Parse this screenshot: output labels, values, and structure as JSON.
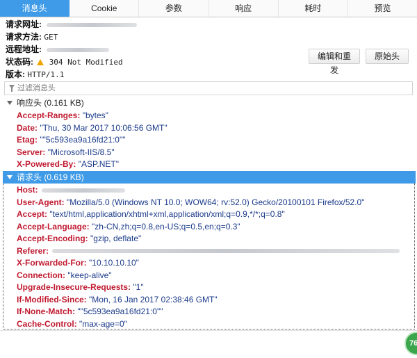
{
  "tabs": [
    "消息头",
    "Cookie",
    "参数",
    "响应",
    "耗时",
    "预览"
  ],
  "summary": {
    "url_label": "请求网址:",
    "method_label": "请求方法:",
    "method_value": "GET",
    "remote_label": "远程地址:",
    "status_label": "状态码:",
    "status_value": "304 Not Modified",
    "version_label": "版本:",
    "version_value": "HTTP/1.1"
  },
  "buttons": {
    "resend": "编辑和重发",
    "raw": "原始头"
  },
  "filter": {
    "placeholder": "过滤消息头"
  },
  "response": {
    "title": "响应头 (0.161 KB)",
    "headers": [
      {
        "name": "Accept-Ranges:",
        "value": "\"bytes\""
      },
      {
        "name": "Date:",
        "value": "\"Thu, 30 Mar 2017 10:06:56 GMT\""
      },
      {
        "name": "Etag:",
        "value": "\"\"5c593ea9a16fd21:0\"\""
      },
      {
        "name": "Server:",
        "value": "\"Microsoft-IIS/8.5\""
      },
      {
        "name": "X-Powered-By:",
        "value": "\"ASP.NET\""
      }
    ]
  },
  "request": {
    "title": "请求头 (0.619 KB)",
    "headers": [
      {
        "name": "Host:",
        "value": ""
      },
      {
        "name": "User-Agent:",
        "value": "\"Mozilla/5.0 (Windows NT 10.0; WOW64; rv:52.0) Gecko/20100101 Firefox/52.0\""
      },
      {
        "name": "Accept:",
        "value": "\"text/html,application/xhtml+xml,application/xml;q=0.9,*/*;q=0.8\""
      },
      {
        "name": "Accept-Language:",
        "value": "\"zh-CN,zh;q=0.8,en-US;q=0.5,en;q=0.3\""
      },
      {
        "name": "Accept-Encoding:",
        "value": "\"gzip, deflate\""
      },
      {
        "name": "Referer:",
        "value": ""
      },
      {
        "name": "X-Forwarded-For:",
        "value": "\"10.10.10.10\""
      },
      {
        "name": "Connection:",
        "value": "\"keep-alive\""
      },
      {
        "name": "Upgrade-Insecure-Requests:",
        "value": "\"1\""
      },
      {
        "name": "If-Modified-Since:",
        "value": "\"Mon, 16 Jan 2017 02:38:46 GMT\""
      },
      {
        "name": "If-None-Match:",
        "value": "\"\"5c593ea9a16fd21:0\"\""
      },
      {
        "name": "Cache-Control:",
        "value": "\"max-age=0\""
      }
    ]
  },
  "badge": "76",
  "colors": {
    "accent": "#3f9be7",
    "header_name": "#c01a30",
    "header_value": "#1a3a8a",
    "warning": "#f0a400",
    "badge": "#3aa54a"
  },
  "icons": {
    "status": "warning-triangle-icon",
    "filter": "funnel-icon",
    "section_toggle": "twisty-icon"
  }
}
